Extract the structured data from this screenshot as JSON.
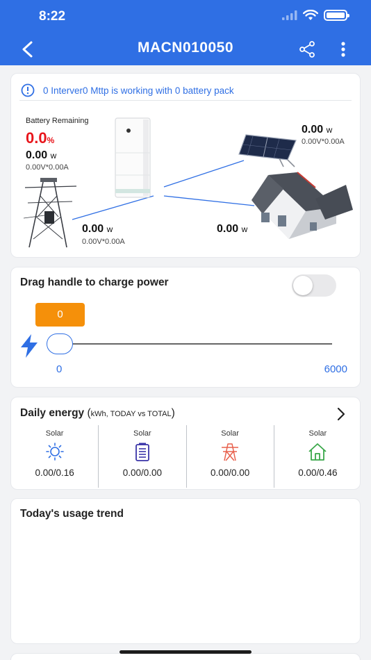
{
  "status_bar": {
    "time": "8:22"
  },
  "nav": {
    "title": "MACN010050",
    "back_icon": "chevron-left-icon",
    "share_icon": "share-icon",
    "more_icon": "more-vertical-icon"
  },
  "device": {
    "info_message": "0 Interver0 Mttp is working with 0 battery pack",
    "battery_label": "Battery Remaining",
    "battery_pct": "0.0",
    "pct_unit": "%",
    "battery_power": "0.00",
    "battery_va": "0.00V*0.00A",
    "solar_power": "0.00",
    "solar_va": "0.00V*0.00A",
    "grid_power": "0.00",
    "grid_va": "0.00V*0.00A",
    "home_power": "0.00",
    "watt_unit": "w"
  },
  "charge": {
    "title": "Drag handle to charge power",
    "toggle_on": false,
    "value": "0",
    "min": "0",
    "max": "6000",
    "bolt_icon": "lightning-icon"
  },
  "daily_energy": {
    "title": "Daily energy",
    "unit_note": "kWh, TODAY vs TOTAL",
    "open_paren": "(",
    "close_paren": ")",
    "columns": [
      {
        "label": "Solar",
        "icon": "sun-icon",
        "value": "0.00/0.16",
        "color": "#2f6fe4"
      },
      {
        "label": "Solar",
        "icon": "battery-icon",
        "value": "0.00/0.00",
        "color": "#3a34a8"
      },
      {
        "label": "Solar",
        "icon": "power-tower-icon",
        "value": "0.00/0.00",
        "color": "#e8604c"
      },
      {
        "label": "Solar",
        "icon": "house-icon",
        "value": "0.00/0.46",
        "color": "#3aa84a"
      }
    ]
  },
  "trend": {
    "title": "Today's usage trend"
  },
  "colors": {
    "primary": "#2f6fe4",
    "alert": "#e8151b",
    "slider_value": "#f5900a"
  }
}
